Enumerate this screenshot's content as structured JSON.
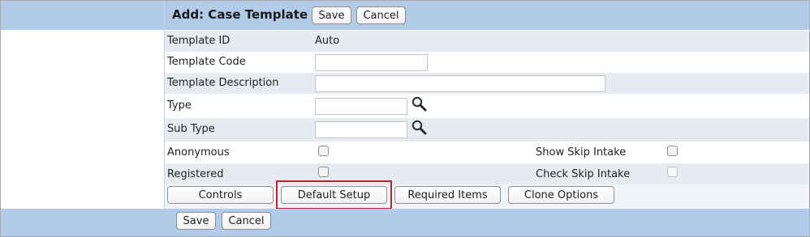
{
  "header": {
    "title": "Add: Case Template",
    "save_label": "Save",
    "cancel_label": "Cancel"
  },
  "form": {
    "template_id": {
      "label": "Template ID",
      "value": "Auto"
    },
    "template_code": {
      "label": "Template Code",
      "value": ""
    },
    "template_description": {
      "label": "Template Description",
      "value": ""
    },
    "type": {
      "label": "Type",
      "value": ""
    },
    "sub_type": {
      "label": "Sub Type",
      "value": ""
    },
    "anonymous": {
      "label": "Anonymous",
      "checked": false
    },
    "show_skip_intake": {
      "label": "Show Skip Intake",
      "checked": false
    },
    "registered": {
      "label": "Registered",
      "checked": false
    },
    "check_skip_intake": {
      "label": "Check Skip Intake",
      "checked": false,
      "disabled": true
    }
  },
  "actions": {
    "controls": "Controls",
    "default_setup": "Default Setup",
    "required_items": "Required Items",
    "clone_options": "Clone Options"
  },
  "footer": {
    "save_label": "Save",
    "cancel_label": "Cancel"
  },
  "colors": {
    "band": "#b1cbe9",
    "alt_row": "#e6ebf2",
    "highlight": "#b8232b"
  }
}
